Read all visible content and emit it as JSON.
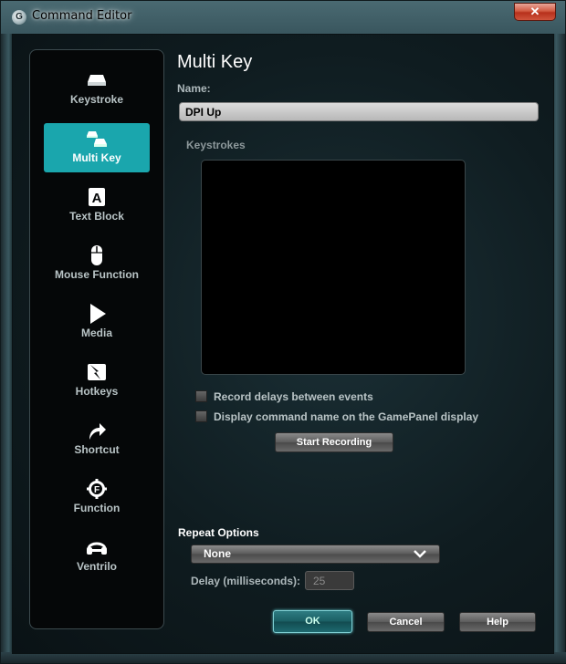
{
  "window": {
    "title": "Command Editor",
    "close_glyph": "✕",
    "app_icon_glyph": "G"
  },
  "sidebar": {
    "items": [
      {
        "label": "Keystroke",
        "icon": "keycap-icon",
        "active": false
      },
      {
        "label": "Multi Key",
        "icon": "multi-keycap-icon",
        "active": true
      },
      {
        "label": "Text Block",
        "icon": "text-block-icon",
        "active": false,
        "glyph": "A"
      },
      {
        "label": "Mouse Function",
        "icon": "mouse-icon",
        "active": false
      },
      {
        "label": "Media",
        "icon": "play-icon",
        "active": false
      },
      {
        "label": "Hotkeys",
        "icon": "hotkey-icon",
        "active": false
      },
      {
        "label": "Shortcut",
        "icon": "shortcut-arrow-icon",
        "active": false
      },
      {
        "label": "Function",
        "icon": "function-gear-icon",
        "active": false,
        "glyph": "F"
      },
      {
        "label": "Ventrilo",
        "icon": "headset-icon",
        "active": false
      }
    ]
  },
  "main": {
    "title": "Multi Key",
    "name_label": "Name:",
    "name_value": "DPI Up",
    "keystrokes_label": "Keystrokes",
    "options": [
      {
        "label": "Record delays between events",
        "checked": false
      },
      {
        "label": "Display command name on the GamePanel display",
        "checked": false
      }
    ],
    "record_button": "Start Recording",
    "repeat_label": "Repeat Options",
    "repeat_selected": "None",
    "delay_label": "Delay (milliseconds):",
    "delay_value": "25"
  },
  "footer": {
    "ok": "OK",
    "cancel": "Cancel",
    "help": "Help"
  },
  "colors": {
    "accent": "#1aa6ad",
    "sidebar_bg": "#050708",
    "text_primary": "#ffffff",
    "text_secondary": "#b9c4c6"
  }
}
